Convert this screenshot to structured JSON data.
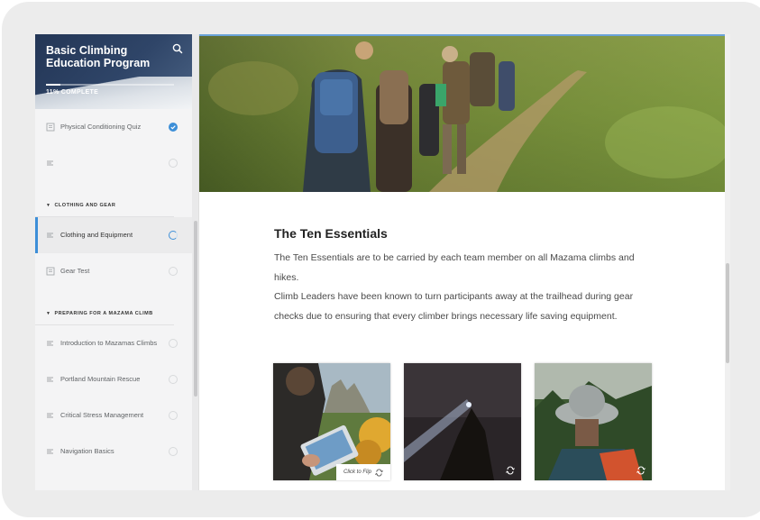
{
  "course": {
    "title": "Basic Climbing Education Program",
    "progress_percent": 11,
    "progress_text": "11% COMPLETE"
  },
  "sidebar": {
    "items": [
      {
        "type": "lesson",
        "label": "Physical Conditioning Quiz",
        "icon": "quiz-icon",
        "status": "complete"
      },
      {
        "type": "lesson",
        "label": "",
        "icon": "text-lesson-icon",
        "status": "not-started"
      },
      {
        "type": "section",
        "label": "CLOTHING AND GEAR"
      },
      {
        "type": "lesson",
        "label": "Clothing and Equipment",
        "icon": "text-lesson-icon",
        "status": "in-progress",
        "active": true
      },
      {
        "type": "lesson",
        "label": "Gear Test",
        "icon": "quiz-icon",
        "status": "not-started"
      },
      {
        "type": "section",
        "label": "PREPARING FOR A MAZAMA CLIMB"
      },
      {
        "type": "lesson",
        "label": "Introduction to Mazamas Climbs",
        "icon": "text-lesson-icon",
        "status": "not-started"
      },
      {
        "type": "lesson",
        "label": "Portland Mountain Rescue",
        "icon": "text-lesson-icon",
        "status": "not-started"
      },
      {
        "type": "lesson",
        "label": "Critical Stress Management",
        "icon": "text-lesson-icon",
        "status": "not-started"
      },
      {
        "type": "lesson",
        "label": "Navigation Basics",
        "icon": "text-lesson-icon",
        "status": "not-started"
      }
    ]
  },
  "content": {
    "heading": "The Ten Essentials",
    "paragraph1": "The Ten Essentials are to be carried by each team member on all Mazama climbs and hikes.",
    "paragraph2": "Climb Leaders have been known to turn participants away at the trailhead during gear checks due to ensuring that every climber brings necessary life saving equipment.",
    "cards": [
      {
        "image": "navigation-map-photo",
        "flip_label": "Click to Flip"
      },
      {
        "image": "headlamp-photo"
      },
      {
        "image": "sun-hat-backpack-photo"
      }
    ]
  },
  "colors": {
    "accent": "#3d8fd8",
    "header_dark": "#233656"
  }
}
